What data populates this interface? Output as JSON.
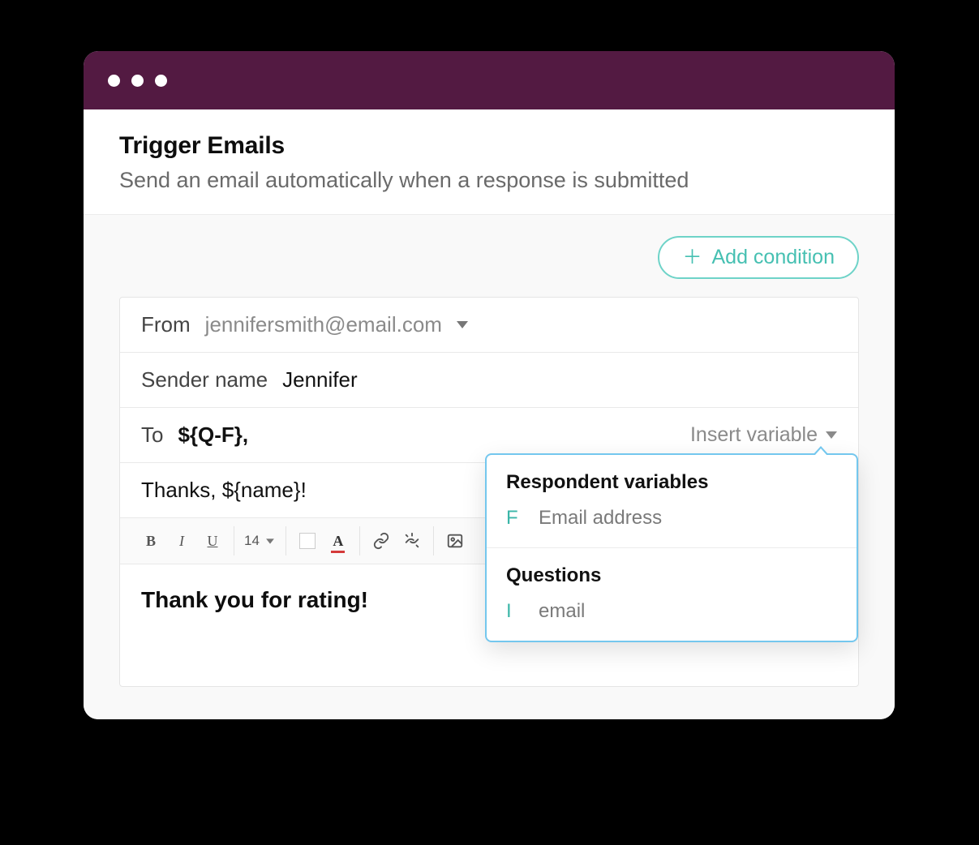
{
  "header": {
    "title": "Trigger Emails",
    "subtitle": "Send an email automatically when a response is submitted"
  },
  "actions": {
    "add_condition": "Add condition"
  },
  "composer": {
    "from_label": "From",
    "from_value": "jennifersmith@email.com",
    "sender_name_label": "Sender name",
    "sender_name_value": "Jennifer",
    "to_label": "To",
    "to_value": "${Q-F},",
    "insert_variable_label": "Insert variable",
    "subject_value": "Thanks, ${name}!",
    "body_value": "Thank you for rating!"
  },
  "toolbar": {
    "font_size": "14"
  },
  "dropdown": {
    "section1_title": "Respondent variables",
    "section1_key": "F",
    "section1_item": "Email address",
    "section2_title": "Questions",
    "section2_key": "I",
    "section2_item": "email"
  },
  "colors": {
    "titlebar": "#531a42",
    "accent": "#46c0b2",
    "dropdown_border": "#74c7ee"
  }
}
